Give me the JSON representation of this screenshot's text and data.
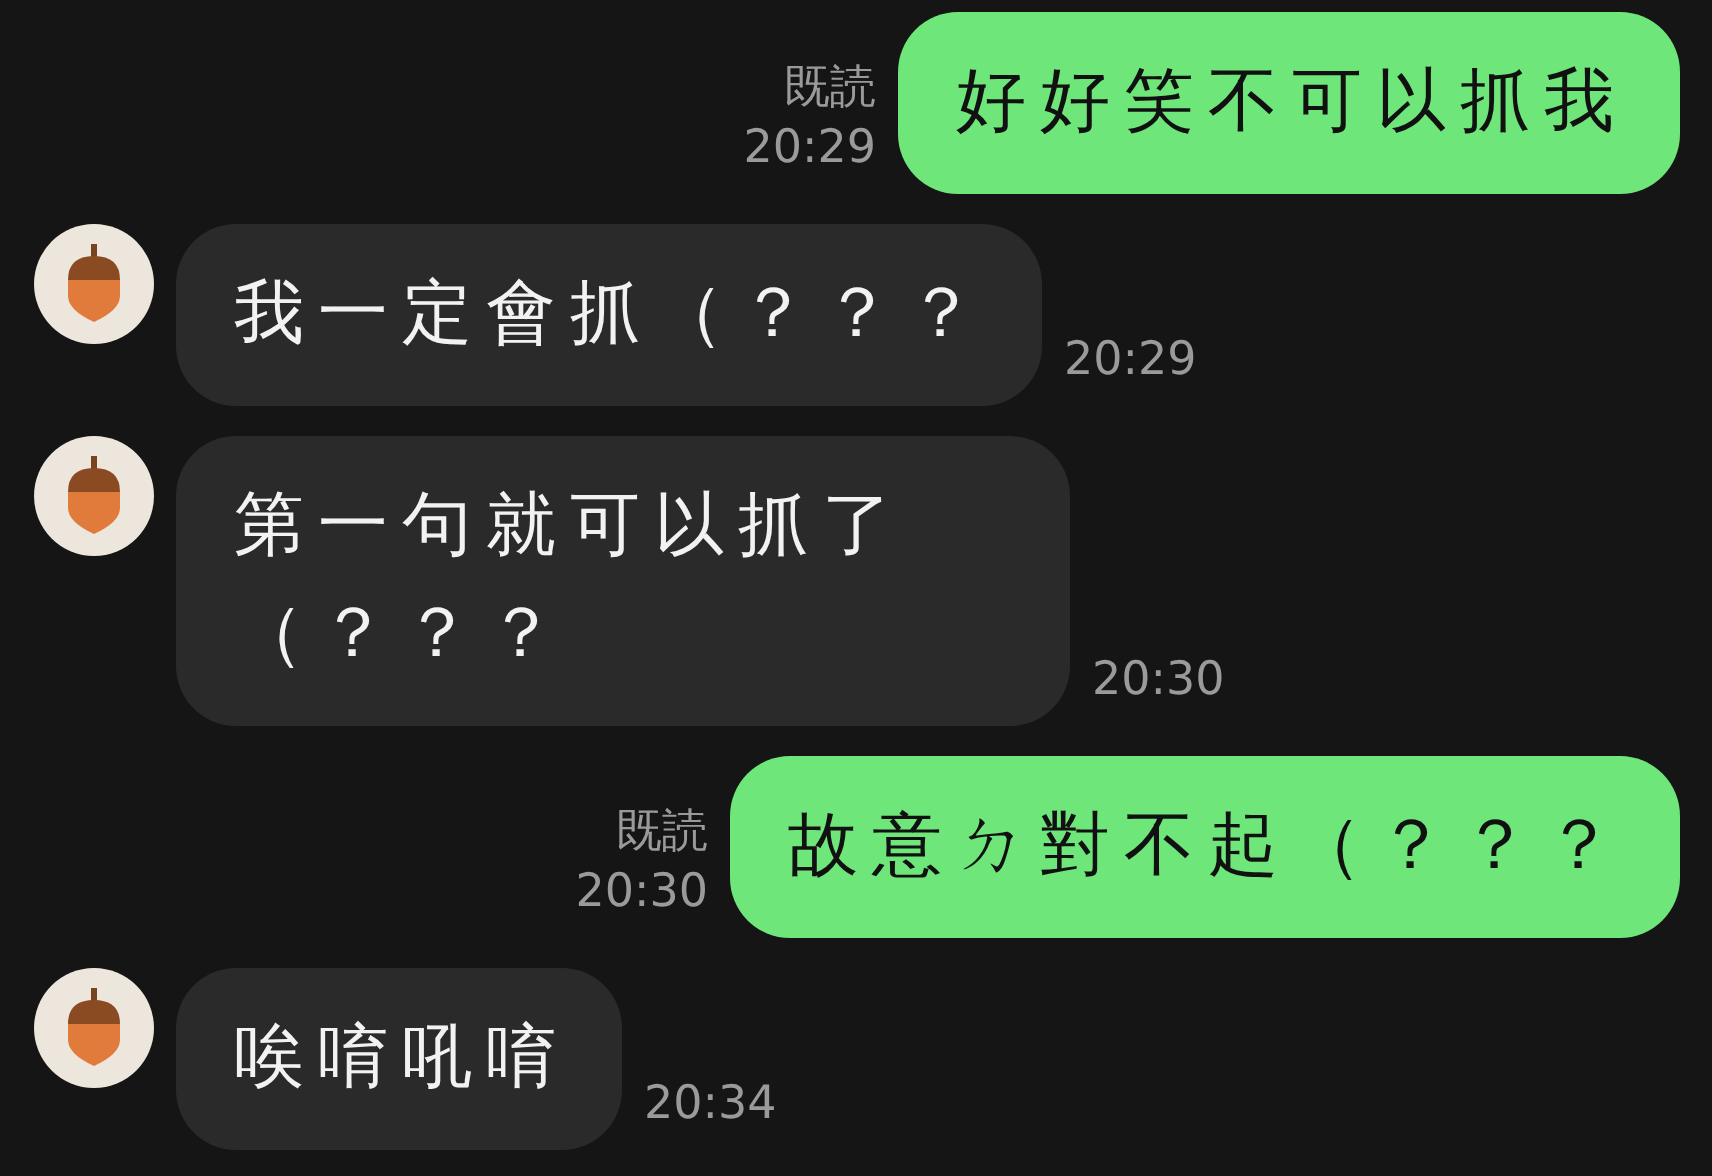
{
  "messages": [
    {
      "kind": "outgoing",
      "text": "好好笑不可以抓我",
      "read": "既読",
      "time": "20:29"
    },
    {
      "kind": "incoming",
      "text": "我一定會抓（？？？",
      "time": "20:29"
    },
    {
      "kind": "incoming",
      "text": "第一句就可以抓了（？？？",
      "time": "20:30"
    },
    {
      "kind": "outgoing",
      "text": "故意ㄉ對不起（？？？",
      "read": "既読",
      "time": "20:30"
    },
    {
      "kind": "incoming",
      "text": "唉唷吼唷",
      "time": "20:34"
    }
  ]
}
